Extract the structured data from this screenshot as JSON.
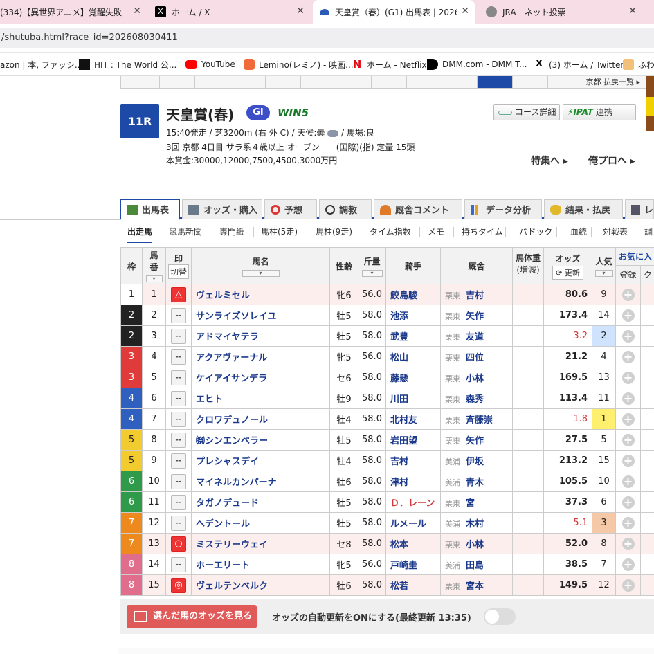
{
  "tabs": [
    {
      "label": "(334)【異世界アニメ】覚醒失敗",
      "icon": "youtube-icon"
    },
    {
      "label": "ホーム / X",
      "icon": "x-icon"
    },
    {
      "label": "天皇賞（春）(G1) 出馬表 | 2026",
      "icon": "netkeiba-icon"
    },
    {
      "label": "JRA　ネット投票",
      "icon": "globe-icon"
    }
  ],
  "address": "/shutuba.html?race_id=202608030411",
  "bookmarks": [
    {
      "label": "azon | 本, ファッシ...",
      "icon": "amazon-icon"
    },
    {
      "label": "HIT : The World 公...",
      "icon": "hit-icon"
    },
    {
      "label": "YouTube",
      "icon": "youtube-icon"
    },
    {
      "label": "Lemino(レミノ) - 映画...",
      "icon": "lemino-icon"
    },
    {
      "label": "ホーム - Netflix",
      "icon": "netflix-icon"
    },
    {
      "label": "DMM.com - DMM T...",
      "icon": "dmm-icon"
    },
    {
      "label": "(3) ホーム / Twitter",
      "icon": "x-icon"
    },
    {
      "label": "ふわ",
      "icon": "fuwa-icon"
    }
  ],
  "top_link": "京都 払戻一覧 ▸",
  "race": {
    "number": "11R",
    "name": "天皇賞(春)",
    "grade": "GI",
    "win5": "WIN5",
    "line1": "15:40発走 / 芝3200m (右 外 C) / 天候:曇",
    "line1b": "/ 馬場:良",
    "line2": "3回 京都 4日目 サラ系４歳以上 オープン　　(国際)(指) 定量 15頭",
    "line3": "本賞金:30000,12000,7500,4500,3000万円",
    "course_btn": "コース詳細",
    "ipat_btn": "IPAT",
    "ipat_suffix": "連携",
    "feature_link": "特集へ ▸",
    "pro_link": "俺プロへ ▸"
  },
  "main_tabs": [
    "出馬表",
    "オッズ・購入",
    "予想",
    "調教",
    "厩舎コメント",
    "データ分析",
    "結果・払戻",
    "レ"
  ],
  "sub_tabs": [
    "出走馬",
    "競馬新聞",
    "専門紙",
    "馬柱(5走)",
    "馬柱(9走)",
    "タイム指数",
    "メモ",
    "持ちタイム",
    "パドック",
    "血統",
    "対戦表",
    "調"
  ],
  "headers": {
    "waku": "枠",
    "umaban1": "馬",
    "umaban2": "番",
    "mark1": "印",
    "mark2": "切替",
    "name": "馬名",
    "sexage": "性齢",
    "kinryo": "斤量",
    "jockey": "騎手",
    "trainer": "厩舎",
    "weight1": "馬体重",
    "weight2": "(増減)",
    "odds": "オッズ",
    "odds_update": "⟳ 更新",
    "pop": "人気",
    "fav1": "お気に入",
    "fav2": "登録",
    "fav3": "ク"
  },
  "horses": [
    {
      "waku": "1",
      "num": "1",
      "mark": "△",
      "name": "ヴェルミセル",
      "sexage": "牝6",
      "kinryo": "56.0",
      "jockey": "鮫島駿",
      "region": "栗東",
      "trainer": "吉村",
      "odds": "80.6",
      "pop": "9"
    },
    {
      "waku": "2",
      "num": "2",
      "mark": "--",
      "name": "サンライズソレイユ",
      "sexage": "牡5",
      "kinryo": "58.0",
      "jockey": "池添",
      "region": "栗東",
      "trainer": "矢作",
      "odds": "173.4",
      "pop": "14"
    },
    {
      "waku": "2",
      "num": "3",
      "mark": "--",
      "name": "アドマイヤテラ",
      "sexage": "牡5",
      "kinryo": "58.0",
      "jockey": "武豊",
      "region": "栗東",
      "trainer": "友道",
      "odds": "3.2",
      "pop": "2"
    },
    {
      "waku": "3",
      "num": "4",
      "mark": "--",
      "name": "アクアヴァーナル",
      "sexage": "牝5",
      "kinryo": "56.0",
      "jockey": "松山",
      "region": "栗東",
      "trainer": "四位",
      "odds": "21.2",
      "pop": "4"
    },
    {
      "waku": "3",
      "num": "5",
      "mark": "--",
      "name": "ケイアイサンデラ",
      "sexage": "セ6",
      "kinryo": "58.0",
      "jockey": "藤懸",
      "region": "栗東",
      "trainer": "小林",
      "odds": "169.5",
      "pop": "13"
    },
    {
      "waku": "4",
      "num": "6",
      "mark": "--",
      "name": "エヒト",
      "sexage": "牡9",
      "kinryo": "58.0",
      "jockey": "川田",
      "region": "栗東",
      "trainer": "森秀",
      "odds": "113.4",
      "pop": "11"
    },
    {
      "waku": "4",
      "num": "7",
      "mark": "--",
      "name": "クロワデュノール",
      "sexage": "牡4",
      "kinryo": "58.0",
      "jockey": "北村友",
      "region": "栗東",
      "trainer": "斉藤崇",
      "odds": "1.8",
      "pop": "1"
    },
    {
      "waku": "5",
      "num": "8",
      "mark": "--",
      "name": "㉀シンエンペラー",
      "sexage": "牡5",
      "kinryo": "58.0",
      "jockey": "岩田望",
      "region": "栗東",
      "trainer": "矢作",
      "odds": "27.5",
      "pop": "5"
    },
    {
      "waku": "5",
      "num": "9",
      "mark": "--",
      "name": "プレシャスデイ",
      "sexage": "牡4",
      "kinryo": "58.0",
      "jockey": "吉村",
      "region": "美浦",
      "trainer": "伊坂",
      "odds": "213.2",
      "pop": "15"
    },
    {
      "waku": "6",
      "num": "10",
      "mark": "--",
      "name": "マイネルカンパーナ",
      "sexage": "牡6",
      "kinryo": "58.0",
      "jockey": "津村",
      "region": "美浦",
      "trainer": "青木",
      "odds": "105.5",
      "pop": "10"
    },
    {
      "waku": "6",
      "num": "11",
      "mark": "--",
      "name": "タガノデュード",
      "sexage": "牡5",
      "kinryo": "58.0",
      "jockey": "Ｄ．レーン",
      "region": "栗東",
      "trainer": "宮",
      "odds": "37.3",
      "pop": "6"
    },
    {
      "waku": "7",
      "num": "12",
      "mark": "--",
      "name": "ヘデントール",
      "sexage": "牡5",
      "kinryo": "58.0",
      "jockey": "ルメール",
      "region": "美浦",
      "trainer": "木村",
      "odds": "5.1",
      "pop": "3"
    },
    {
      "waku": "7",
      "num": "13",
      "mark": "○",
      "name": "ミステリーウェイ",
      "sexage": "セ8",
      "kinryo": "58.0",
      "jockey": "松本",
      "region": "栗東",
      "trainer": "小林",
      "odds": "52.0",
      "pop": "8"
    },
    {
      "waku": "8",
      "num": "14",
      "mark": "--",
      "name": "ホーエリート",
      "sexage": "牝5",
      "kinryo": "56.0",
      "jockey": "戸崎圭",
      "region": "美浦",
      "trainer": "田島",
      "odds": "38.5",
      "pop": "7"
    },
    {
      "waku": "8",
      "num": "15",
      "mark": "◎",
      "name": "ヴェルテンベルク",
      "sexage": "牡6",
      "kinryo": "58.0",
      "jockey": "松若",
      "region": "栗東",
      "trainer": "宮本",
      "odds": "149.5",
      "pop": "12"
    }
  ],
  "bottom": {
    "odds_button": "選んだ馬のオッズを見る",
    "auto_update": "オッズの自動更新をONにする(最終更新 13:35)"
  },
  "colors": {
    "waku1": "#ffffff",
    "waku2": "#222222",
    "waku3": "#e03b3b",
    "waku4": "#2f5fbf",
    "waku5": "#f2cc2e",
    "waku6": "#2f9a4a",
    "waku7": "#ee8a1d",
    "waku8": "#e16d8c",
    "pop1": "#ffef6e",
    "pop2": "#cfe3ff",
    "pop3": "#f5c9a8",
    "accent": "#1d4aa6"
  }
}
